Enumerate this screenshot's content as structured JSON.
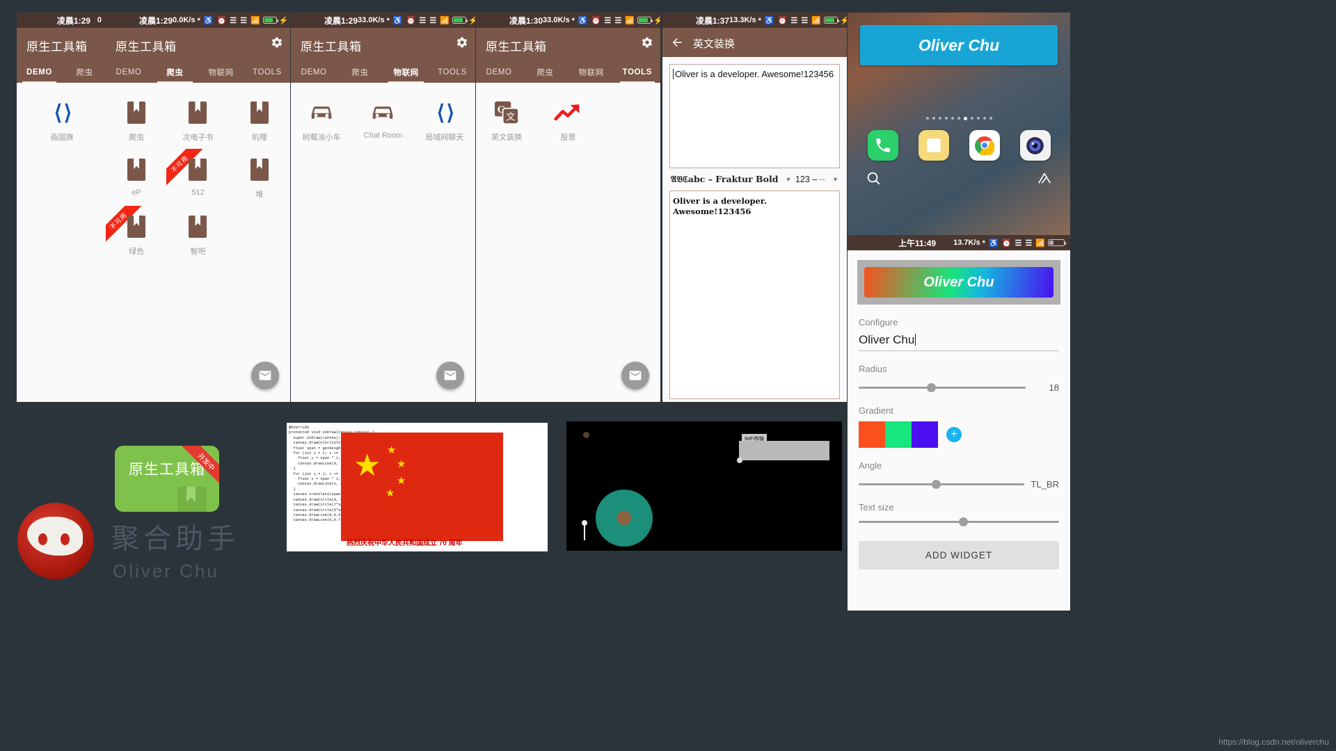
{
  "background_color": "#2b343b",
  "panels": {
    "p1": {
      "status": {
        "time": "凌晨1:29",
        "net": "0"
      },
      "app_title": "原生工具箱",
      "tabs": [
        "DEMO",
        "爬虫"
      ],
      "active_tab": "DEMO",
      "items": [
        {
          "label": "画国旗",
          "icon": "code-brackets-icon",
          "badge": ""
        }
      ]
    },
    "p2": {
      "status": {
        "time": "凌晨1:29",
        "net": "0.0K/s"
      },
      "app_title": "原生工具箱",
      "tabs": [
        "DEMO",
        "爬虫",
        "物联网",
        "TOOLS"
      ],
      "active_tab": "爬虫",
      "items": [
        {
          "label": "爬虫",
          "icon": "bookmark-icon",
          "badge": ""
        },
        {
          "label": "次电子书",
          "icon": "bookmark-icon",
          "badge": ""
        },
        {
          "label": "叽哩",
          "icon": "bookmark-icon",
          "badge": ""
        },
        {
          "label": "eP",
          "icon": "bookmark-icon",
          "badge": ""
        },
        {
          "label": "512",
          "icon": "bookmark-icon",
          "badge": "不可用"
        },
        {
          "label": "堆",
          "icon": "bookmark-icon",
          "badge": ""
        },
        {
          "label": "绿色",
          "icon": "bookmark-icon",
          "badge": "不可用"
        },
        {
          "label": "智吧",
          "icon": "bookmark-icon",
          "badge": ""
        }
      ],
      "fab": "mail-icon"
    },
    "p3": {
      "status": {
        "time": "凌晨1:29",
        "net": "33.0K/s"
      },
      "app_title": "原生工具箱",
      "tabs": [
        "DEMO",
        "爬虫",
        "物联网",
        "TOOLS"
      ],
      "active_tab": "物联网",
      "items": [
        {
          "label": "树莓派小车",
          "icon": "car-icon"
        },
        {
          "label": "Chat Room",
          "icon": "car-icon"
        },
        {
          "label": "局域网聊天",
          "icon": "code-brackets-icon"
        }
      ],
      "fab": "mail-icon"
    },
    "p4": {
      "status": {
        "time": "凌晨1:30",
        "net": "33.0K/s"
      },
      "app_title": "原生工具箱",
      "tabs": [
        "DEMO",
        "爬虫",
        "物联网",
        "TOOLS"
      ],
      "active_tab": "TOOLS",
      "items": [
        {
          "label": "英文装换",
          "icon": "translate-icon"
        },
        {
          "label": "股票",
          "icon": "trend-up-icon"
        }
      ],
      "fab": "mail-icon"
    },
    "p5": {
      "status": {
        "time": "凌晨1:37",
        "net": "13.3K/s"
      },
      "title": "英文装换",
      "back_icon": "back-arrow-icon",
      "input_text": "Oliver is a developer. Awesome!123456",
      "font_select": "𝔄𝔅ℭabc – Fraktur Bold",
      "number_select": "123 – ··",
      "output_text": "Oliver is a developer. Awesome!123456"
    },
    "launcher": {
      "widget_text": "Oliver Chu",
      "widget_color": "#18a5d6",
      "page_dots": 11,
      "active_dot": 7,
      "dock": [
        "phone-icon",
        "notes-icon",
        "chrome-icon",
        "camera-icon"
      ],
      "search_icon": "search-icon",
      "assistant_icon": "assistant-icon"
    },
    "config": {
      "status": {
        "time": "上午11:49",
        "net": "13.7K/s",
        "battery": "26"
      },
      "preview_text": "Oliver Chu",
      "configure_label": "Configure",
      "name_value": "Oliver Chu",
      "radius_label": "Radius",
      "radius_value": "18",
      "gradient_label": "Gradient",
      "gradient_colors": [
        "#f9501e",
        "#17e57d",
        "#4b0ff0"
      ],
      "add_color_icon": "plus-circle-icon",
      "angle_label": "Angle",
      "angle_value": "TL_BR",
      "text_size_label": "Text size",
      "add_widget_button": "ADD WIDGET"
    }
  },
  "footer": {
    "logo_text": "原生工具箱",
    "logo_badge": "开发中",
    "brand_title": "聚合助手",
    "brand_sub": "Oliver Chu",
    "avatar": "red-face-avatar"
  },
  "shots": {
    "flag_caption": "热烈庆祝中华人民共和国成立 70 周年",
    "code_text": "@Override\nprotected void onDraw(Canvas canvas) {\n  super.onDraw(canvas);\n  canvas.drawColor(Color.RED);\n  float span = getHeight() / 30f;\n  for (int i = 1; i <= 10; i++) {\n    float y = span * i;\n    canvas.drawLine(0, y, getWidth(), y, paint);\n  }\n  for (int i = 1; i <= 15; i++) {\n    float x = span * i;\n    canvas.drawLine(x, 0, x, getHeight(), paint);\n  }\n  canvas.translate(span, span);\n  canvas.drawCircle(0, 0, span * 3, paint);\n  canvas.drawCircle(7*span,2*span,span,paint);\n  canvas.drawCircle(5*span,5*span,span,paint);\n  canvas.drawLine(0,0.5f*span,-1*span,paint);\n  canvas.drawLine(0,0.7*span,-1*span,paint);",
    "wifi_label": "WiFi传输"
  },
  "watermark": "https://blog.csdn.net/oliverchu"
}
